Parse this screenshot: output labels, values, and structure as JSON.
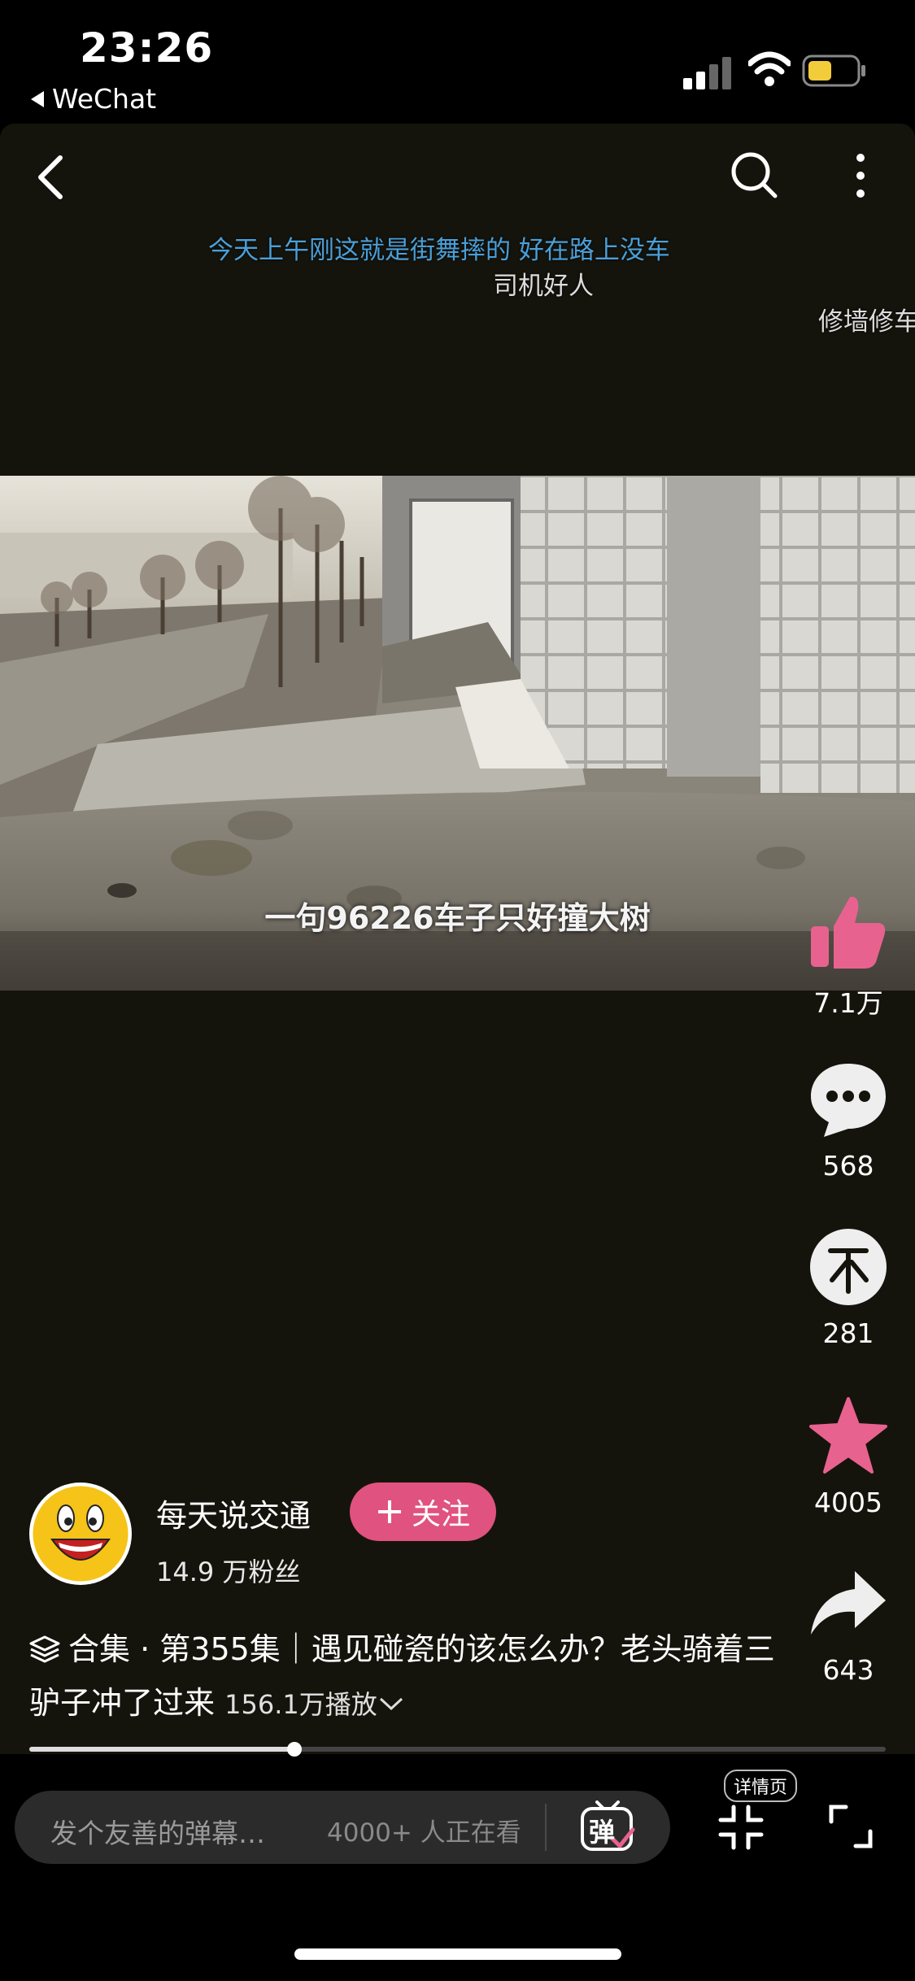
{
  "status": {
    "time": "23:26",
    "back_app": "WeChat"
  },
  "danmu": [
    {
      "text": "今天上午刚这就是街舞摔的 好在路上没车",
      "color": "#4a9fd8"
    },
    {
      "text": "司机好人",
      "color": "#dcdcdc"
    },
    {
      "text": "修墙修车",
      "color": "#dcdcdc"
    }
  ],
  "video": {
    "subtitle": "一句96226车子只好撞大树"
  },
  "actions": {
    "likes": "7.1万",
    "comments": "568",
    "coins": "281",
    "favorites": "4005",
    "shares": "643"
  },
  "author": {
    "name": "每天说交通",
    "follow_label": "关注",
    "fans": "14.9 万粉丝"
  },
  "post": {
    "collection": "合集",
    "sep": " · ",
    "title": "第355集｜遇见碰瓷的该怎么办？老头骑着三驴子冲了过来",
    "views": "156.1万播放"
  },
  "progress": {
    "fraction": 0.31
  },
  "bottom": {
    "input_placeholder": "发个友善的弹幕…",
    "watching": "4000+ 人正在看",
    "danmu_toggle": "弹",
    "detail_badge": "详情页"
  },
  "colors": {
    "accent": "#e0527f",
    "panel": "#15140c"
  }
}
